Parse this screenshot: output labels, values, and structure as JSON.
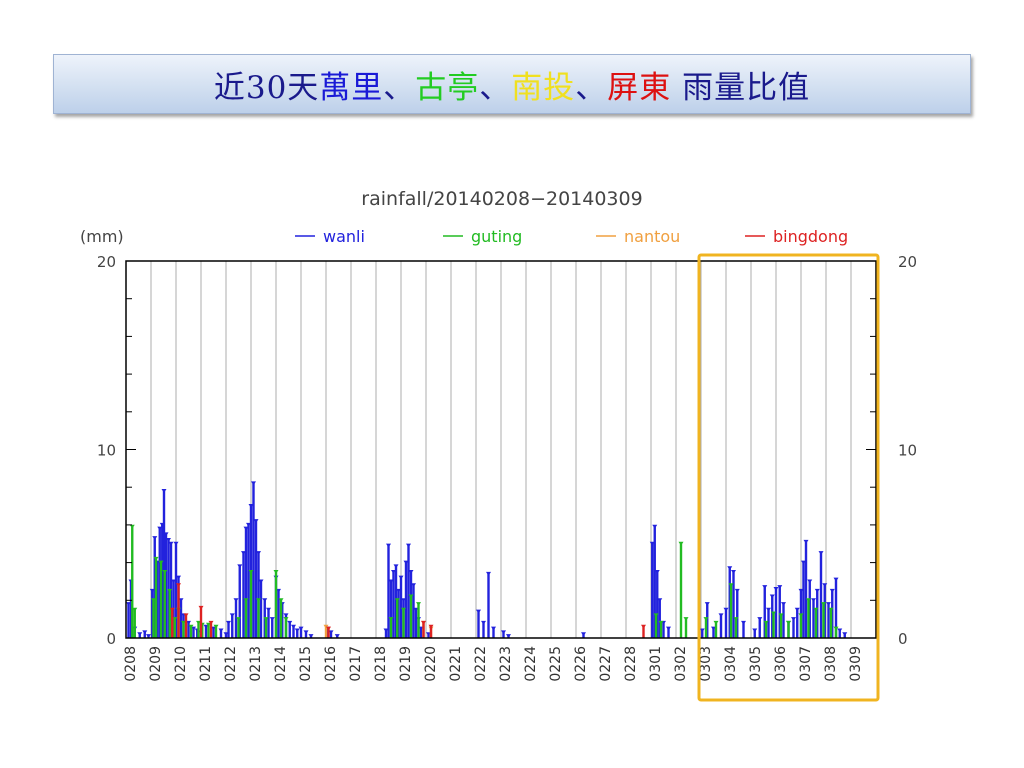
{
  "slide": {
    "title_parts": [
      {
        "text": "近30天",
        "color": "#1a1a8c"
      },
      {
        "text": "萬里",
        "color": "#1a1ad6"
      },
      {
        "text": "、",
        "color": "#1a1a8c"
      },
      {
        "text": "古亭",
        "color": "#22cc22"
      },
      {
        "text": "、",
        "color": "#1a1a8c"
      },
      {
        "text": "南投",
        "color": "#f0e020"
      },
      {
        "text": "、",
        "color": "#1a1a8c"
      },
      {
        "text": "屏東",
        "color": "#dd1111"
      },
      {
        "text": " 雨量比值",
        "color": "#1a1a8c"
      }
    ]
  },
  "chart_data": {
    "type": "bar",
    "title": "rainfall/20140208−20140309",
    "ylabel": "(mm)",
    "ylim": [
      0,
      20
    ],
    "yticks": [
      0,
      10,
      20
    ],
    "grid": true,
    "legend_placement": "top",
    "categories": [
      "0208",
      "0209",
      "0210",
      "0211",
      "0212",
      "0213",
      "0214",
      "0215",
      "0216",
      "0217",
      "0218",
      "0219",
      "0220",
      "0221",
      "0222",
      "0223",
      "0224",
      "0225",
      "0226",
      "0227",
      "0228",
      "0301",
      "0302",
      "0303",
      "0304",
      "0305",
      "0306",
      "0307",
      "0308",
      "0309"
    ],
    "highlight": {
      "from": "0303",
      "to": "0309",
      "color": "#f0b420"
    },
    "series": [
      {
        "name": "wanli",
        "color": "#2222dd",
        "points": [
          [
            0.1,
            1.8
          ],
          [
            0.2,
            3.0
          ],
          [
            0.35,
            0.5
          ],
          [
            0.55,
            0.2
          ],
          [
            0.75,
            0.3
          ],
          [
            0.9,
            0.1
          ],
          [
            1.05,
            2.5
          ],
          [
            1.15,
            5.3
          ],
          [
            1.25,
            4.0
          ],
          [
            1.35,
            5.8
          ],
          [
            1.45,
            6.0
          ],
          [
            1.52,
            7.8
          ],
          [
            1.6,
            5.5
          ],
          [
            1.7,
            5.2
          ],
          [
            1.8,
            5.0
          ],
          [
            1.9,
            3.0
          ],
          [
            2.0,
            5.0
          ],
          [
            2.1,
            3.2
          ],
          [
            2.2,
            2.0
          ],
          [
            2.3,
            1.2
          ],
          [
            2.5,
            0.8
          ],
          [
            2.7,
            0.5
          ],
          [
            2.85,
            0.4
          ],
          [
            3.0,
            0.3
          ],
          [
            3.2,
            0.6
          ],
          [
            3.5,
            0.5
          ],
          [
            3.8,
            0.4
          ],
          [
            4.0,
            0.2
          ],
          [
            4.1,
            0.8
          ],
          [
            4.25,
            1.2
          ],
          [
            4.4,
            2.0
          ],
          [
            4.55,
            3.8
          ],
          [
            4.7,
            4.5
          ],
          [
            4.8,
            5.8
          ],
          [
            4.9,
            6.0
          ],
          [
            5.0,
            7.0
          ],
          [
            5.1,
            8.2
          ],
          [
            5.2,
            6.2
          ],
          [
            5.3,
            4.5
          ],
          [
            5.4,
            3.0
          ],
          [
            5.55,
            2.0
          ],
          [
            5.7,
            1.5
          ],
          [
            5.85,
            1.0
          ],
          [
            6.0,
            3.2
          ],
          [
            6.1,
            2.5
          ],
          [
            6.25,
            1.8
          ],
          [
            6.4,
            1.2
          ],
          [
            6.55,
            0.8
          ],
          [
            6.7,
            0.6
          ],
          [
            6.85,
            0.4
          ],
          [
            7.0,
            0.5
          ],
          [
            7.2,
            0.3
          ],
          [
            7.4,
            0.1
          ],
          [
            8.05,
            0.5
          ],
          [
            8.2,
            0.3
          ],
          [
            8.45,
            0.1
          ],
          [
            10.4,
            0.4
          ],
          [
            10.5,
            4.9
          ],
          [
            10.6,
            3.0
          ],
          [
            10.7,
            3.5
          ],
          [
            10.8,
            3.8
          ],
          [
            10.9,
            2.5
          ],
          [
            11.0,
            3.2
          ],
          [
            11.1,
            2.0
          ],
          [
            11.2,
            4.0
          ],
          [
            11.3,
            4.9
          ],
          [
            11.4,
            3.5
          ],
          [
            11.5,
            2.8
          ],
          [
            11.6,
            1.5
          ],
          [
            11.7,
            1.0
          ],
          [
            11.8,
            0.5
          ],
          [
            12.1,
            0.2
          ],
          [
            14.1,
            1.4
          ],
          [
            14.3,
            0.8
          ],
          [
            14.5,
            3.4
          ],
          [
            14.7,
            0.5
          ],
          [
            15.1,
            0.3
          ],
          [
            15.3,
            0.1
          ],
          [
            18.3,
            0.2
          ],
          [
            21.05,
            5.0
          ],
          [
            21.15,
            5.9
          ],
          [
            21.25,
            3.5
          ],
          [
            21.35,
            2.0
          ],
          [
            21.5,
            0.8
          ],
          [
            21.7,
            0.5
          ],
          [
            23.05,
            0.4
          ],
          [
            23.25,
            1.8
          ],
          [
            23.5,
            0.5
          ],
          [
            23.8,
            1.2
          ],
          [
            24.0,
            1.5
          ],
          [
            24.15,
            3.7
          ],
          [
            24.3,
            3.5
          ],
          [
            24.45,
            2.5
          ],
          [
            24.7,
            0.8
          ],
          [
            25.15,
            0.4
          ],
          [
            25.35,
            1.0
          ],
          [
            25.55,
            2.7
          ],
          [
            25.7,
            1.5
          ],
          [
            25.85,
            2.2
          ],
          [
            26.0,
            2.6
          ],
          [
            26.15,
            2.7
          ],
          [
            26.3,
            1.8
          ],
          [
            26.5,
            0.8
          ],
          [
            26.7,
            1.0
          ],
          [
            26.85,
            1.5
          ],
          [
            27.0,
            2.5
          ],
          [
            27.1,
            4.0
          ],
          [
            27.2,
            5.1
          ],
          [
            27.35,
            3.0
          ],
          [
            27.5,
            2.0
          ],
          [
            27.65,
            2.5
          ],
          [
            27.8,
            4.5
          ],
          [
            27.95,
            2.8
          ],
          [
            28.1,
            1.8
          ],
          [
            28.25,
            2.5
          ],
          [
            28.4,
            3.1
          ],
          [
            28.55,
            0.4
          ],
          [
            28.75,
            0.2
          ]
        ]
      },
      {
        "name": "guting",
        "color": "#22bb22",
        "points": [
          [
            0.25,
            5.9
          ],
          [
            0.35,
            1.5
          ],
          [
            1.1,
            2.0
          ],
          [
            1.2,
            4.2
          ],
          [
            1.4,
            4.0
          ],
          [
            1.55,
            3.5
          ],
          [
            1.75,
            2.5
          ],
          [
            1.95,
            1.0
          ],
          [
            2.1,
            1.5
          ],
          [
            2.3,
            0.8
          ],
          [
            2.6,
            0.6
          ],
          [
            2.9,
            0.8
          ],
          [
            3.05,
            0.7
          ],
          [
            3.3,
            0.7
          ],
          [
            3.6,
            0.6
          ],
          [
            4.5,
            1.0
          ],
          [
            4.8,
            2.0
          ],
          [
            5.0,
            3.5
          ],
          [
            5.3,
            2.0
          ],
          [
            5.6,
            1.0
          ],
          [
            6.0,
            3.5
          ],
          [
            6.2,
            2.0
          ],
          [
            6.4,
            1.0
          ],
          [
            10.6,
            1.0
          ],
          [
            10.85,
            2.0
          ],
          [
            11.1,
            1.5
          ],
          [
            11.4,
            2.2
          ],
          [
            11.7,
            1.8
          ],
          [
            21.2,
            1.2
          ],
          [
            21.4,
            0.8
          ],
          [
            22.2,
            5.0
          ],
          [
            22.4,
            1.0
          ],
          [
            23.2,
            1.0
          ],
          [
            23.6,
            0.8
          ],
          [
            24.2,
            2.8
          ],
          [
            24.4,
            1.0
          ],
          [
            25.6,
            0.8
          ],
          [
            25.9,
            1.3
          ],
          [
            26.2,
            1.2
          ],
          [
            26.5,
            0.8
          ],
          [
            27.0,
            1.2
          ],
          [
            27.3,
            2.0
          ],
          [
            27.6,
            1.5
          ],
          [
            27.9,
            1.8
          ],
          [
            28.2,
            1.5
          ],
          [
            28.4,
            0.5
          ]
        ]
      },
      {
        "name": "nantou",
        "color": "#f0a040",
        "points": [
          [
            8.0,
            0.6
          ],
          [
            11.9,
            0.8
          ],
          [
            12.2,
            0.5
          ]
        ]
      },
      {
        "name": "bingdong",
        "color": "#dd2222",
        "points": [
          [
            1.85,
            1.5
          ],
          [
            2.1,
            2.8
          ],
          [
            2.4,
            1.2
          ],
          [
            3.0,
            1.6
          ],
          [
            3.4,
            0.8
          ],
          [
            8.1,
            0.5
          ],
          [
            11.9,
            0.8
          ],
          [
            12.2,
            0.6
          ],
          [
            20.7,
            0.6
          ]
        ]
      }
    ]
  }
}
